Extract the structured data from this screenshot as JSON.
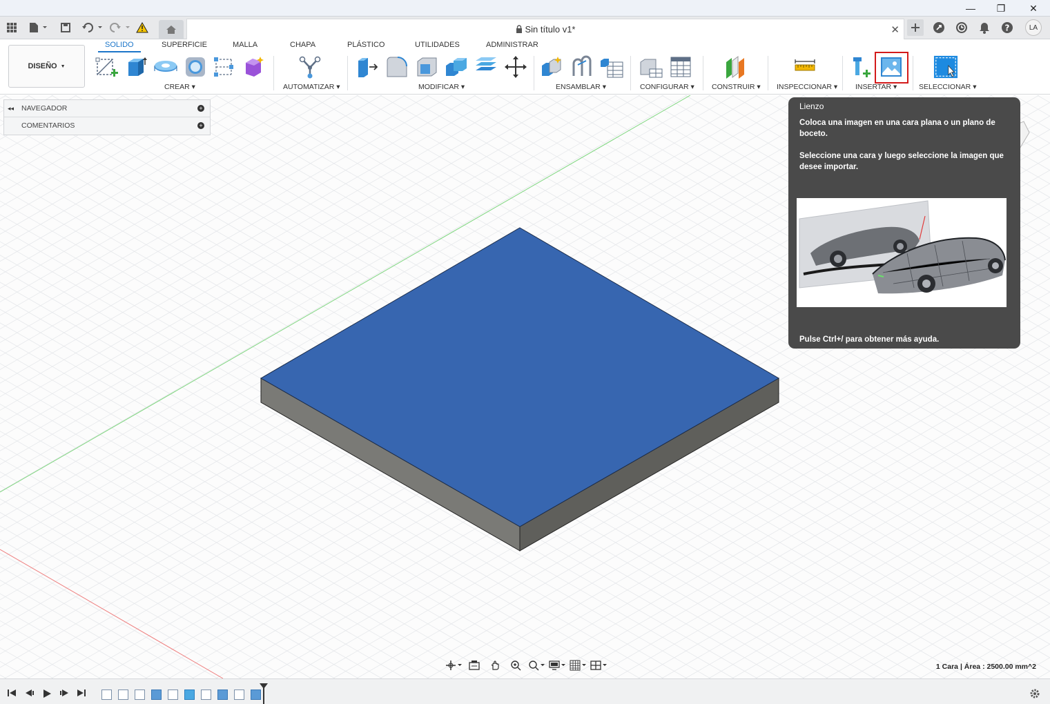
{
  "window": {
    "minimize_glyph": "—",
    "restore_glyph": "❐",
    "close_glyph": "✕"
  },
  "header": {
    "document_title": "Sin título v1*",
    "close_tab_glyph": "✕",
    "user_initials": "LA",
    "icons": [
      "grid-icon",
      "file-icon",
      "save-icon",
      "undo-icon",
      "redo-icon",
      "warning-icon",
      "home-icon",
      "plus-icon",
      "extensions-icon",
      "history-icon",
      "notifications-icon",
      "help-icon"
    ]
  },
  "ribbon": {
    "workspace_label": "DISEÑO",
    "tabs": [
      "SOLIDO",
      "SUPERFICIE",
      "MALLA",
      "CHAPA",
      "PLÁSTICO",
      "UTILIDADES",
      "ADMINISTRAR"
    ],
    "active_tab": "SOLIDO",
    "groups": [
      "CREAR",
      "AUTOMATIZAR",
      "MODIFICAR",
      "ENSAMBLAR",
      "CONFIGURAR",
      "CONSTRUIR",
      "INSPECCIONAR",
      "INSERTAR",
      "SELECCIONAR"
    ],
    "highlighted_tool": "lienzo-insert-image"
  },
  "browser": {
    "items": [
      {
        "label": "NAVEGADOR",
        "collapse_glyph": "◂◂",
        "add_glyph": "+"
      },
      {
        "label": "COMENTARIOS",
        "add_glyph": "+"
      }
    ]
  },
  "tooltip": {
    "title": "Lienzo",
    "paragraph1": "Coloca una imagen en una cara plana o un plano de boceto.",
    "paragraph2": "Seleccione una cara y luego seleccione la imagen que desee importar.",
    "footer": "Pulse Ctrl+/ para obtener más ayuda."
  },
  "status": {
    "selection_info": "1 Cara | Área : 2500.00 mm^2"
  },
  "colors": {
    "accent": "#1b75c9",
    "face_blue": "#3766b0",
    "highlight_red": "#d31a1a",
    "tooltip_bg": "#4a4a4a"
  }
}
